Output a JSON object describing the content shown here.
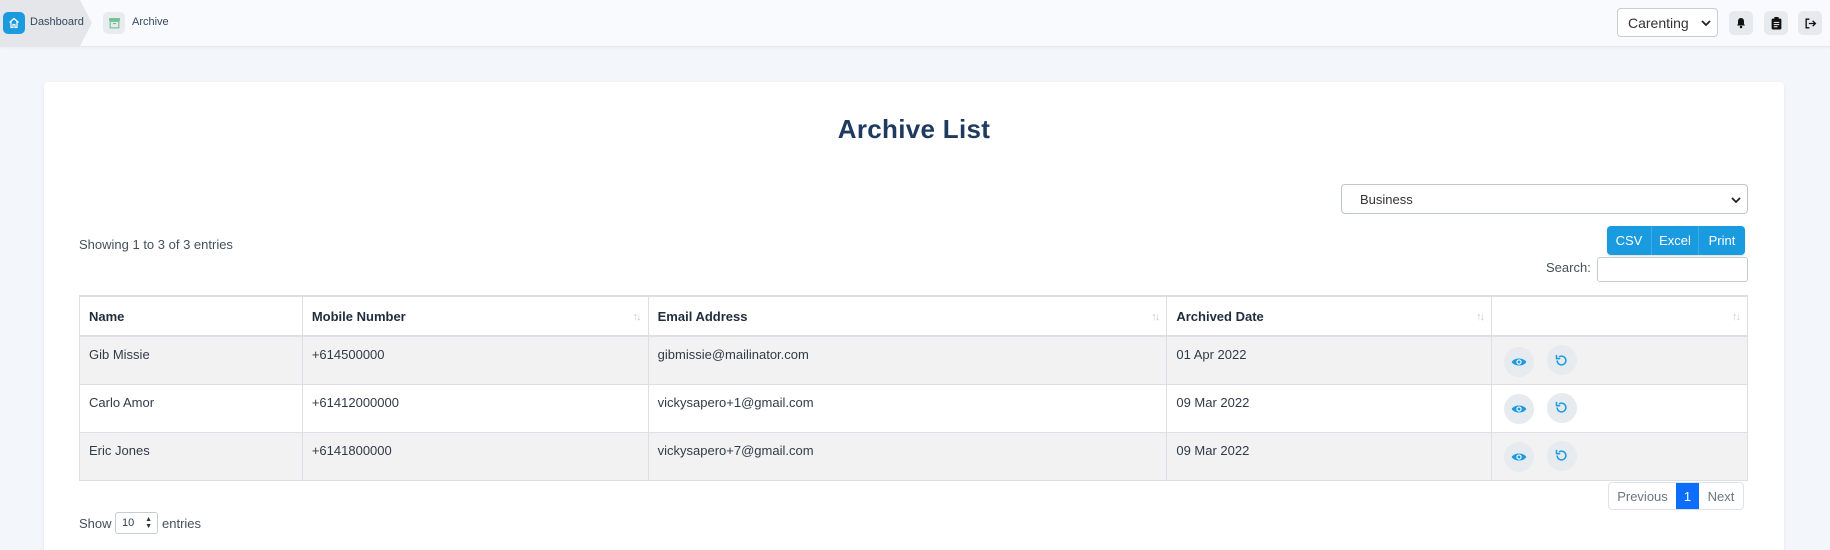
{
  "header": {
    "breadcrumb": {
      "home_label": "Dashboard",
      "current_label": "Archive"
    },
    "tenant_select": {
      "value": "Carenting"
    },
    "icons": [
      "bell-icon",
      "clipboard-icon",
      "logout-icon"
    ]
  },
  "main": {
    "title": "Archive List",
    "filter_select": {
      "value": "Business"
    },
    "info_text": "Showing 1 to 3 of 3 entries",
    "export_buttons": [
      "CSV",
      "Excel",
      "Print"
    ],
    "search": {
      "label": "Search:",
      "value": ""
    },
    "table": {
      "columns": [
        "Name",
        "Mobile Number",
        "Email Address",
        "Archived Date",
        ""
      ],
      "rows": [
        {
          "name": "Gib Missie",
          "mobile": "+614500000",
          "email": "gibmissie@mailinator.com",
          "archived_date": "01 Apr 2022"
        },
        {
          "name": "Carlo Amor",
          "mobile": "+61412000000",
          "email": "vickysapero+1@gmail.com",
          "archived_date": "09 Mar 2022"
        },
        {
          "name": "Eric Jones",
          "mobile": "+6141800000",
          "email": "vickysapero+7@gmail.com",
          "archived_date": "09 Mar 2022"
        }
      ]
    },
    "length_menu": {
      "show_label": "Show",
      "value": "10",
      "entries_label": "entries"
    },
    "pagination": {
      "previous": "Previous",
      "current_page": "1",
      "next": "Next"
    }
  },
  "colors": {
    "accent": "#1a9be0",
    "page_active": "#0d6efd",
    "title": "#1e3a5f"
  }
}
